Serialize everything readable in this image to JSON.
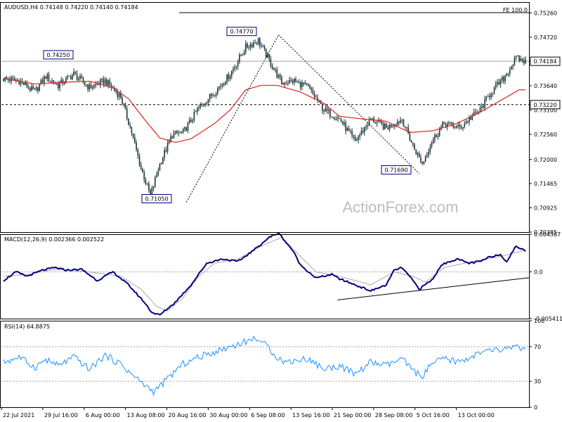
{
  "colors": {
    "candle": "#1a3535",
    "ma": "#dd2222",
    "macd": "#00007f",
    "signal": "#a8a8a8",
    "rsi": "#1e90ff",
    "trend": "#000000",
    "dotted": "#a0a0a0",
    "frame": "#000000",
    "watermark": "#bdbdbd",
    "label_bg": "#ffffff",
    "label_border": "#00007f"
  },
  "chart_data": [
    {
      "type": "candlestick",
      "title": "AUDUSD,H4  0.74148 0.74220 0.74140 0.74184",
      "watermark": "ActionForex.com",
      "fib_label": "FE 100.0",
      "ylim": [
        0.70385,
        0.755
      ],
      "y_ticks": [
        "0.75260",
        "0.74720",
        "0.74184",
        "0.73640",
        "0.73220",
        "0.73100",
        "0.72560",
        "0.72000",
        "0.71465",
        "0.70925",
        "0.70385"
      ],
      "last_price": 0.74184,
      "support_level": 0.7322,
      "annotations": [
        {
          "text": "0.74250",
          "value": 0.7425
        },
        {
          "text": "0.74770",
          "value": 0.7477
        },
        {
          "text": "0.71050",
          "value": 0.7105
        },
        {
          "text": "0.71690",
          "value": 0.7169
        }
      ],
      "moving_average_waypoints": [
        [
          0,
          0.738
        ],
        [
          20,
          0.7368
        ],
        [
          40,
          0.7372
        ],
        [
          55,
          0.7374
        ],
        [
          70,
          0.736
        ],
        [
          80,
          0.7335
        ],
        [
          90,
          0.729
        ],
        [
          100,
          0.7248
        ],
        [
          110,
          0.7238
        ],
        [
          120,
          0.7246
        ],
        [
          135,
          0.728
        ],
        [
          145,
          0.731
        ],
        [
          155,
          0.7355
        ],
        [
          165,
          0.7365
        ],
        [
          175,
          0.7365
        ],
        [
          190,
          0.735
        ],
        [
          205,
          0.7325
        ],
        [
          215,
          0.7296
        ],
        [
          230,
          0.729
        ],
        [
          245,
          0.7285
        ],
        [
          260,
          0.726
        ],
        [
          275,
          0.7264
        ],
        [
          290,
          0.728
        ],
        [
          305,
          0.7305
        ],
        [
          315,
          0.7325
        ],
        [
          330,
          0.7355
        ]
      ],
      "price_waypoints": [
        [
          0,
          0.738
        ],
        [
          10,
          0.7375
        ],
        [
          20,
          0.735
        ],
        [
          27,
          0.7385
        ],
        [
          35,
          0.7365
        ],
        [
          45,
          0.739
        ],
        [
          55,
          0.736
        ],
        [
          65,
          0.7375
        ],
        [
          75,
          0.734
        ],
        [
          82,
          0.726
        ],
        [
          88,
          0.718
        ],
        [
          94,
          0.712
        ],
        [
          100,
          0.719
        ],
        [
          108,
          0.7255
        ],
        [
          115,
          0.726
        ],
        [
          125,
          0.7315
        ],
        [
          135,
          0.735
        ],
        [
          145,
          0.739
        ],
        [
          155,
          0.745
        ],
        [
          163,
          0.7465
        ],
        [
          170,
          0.742
        ],
        [
          178,
          0.737
        ],
        [
          186,
          0.7375
        ],
        [
          195,
          0.736
        ],
        [
          205,
          0.731
        ],
        [
          215,
          0.729
        ],
        [
          225,
          0.724
        ],
        [
          235,
          0.729
        ],
        [
          245,
          0.727
        ],
        [
          255,
          0.729
        ],
        [
          262,
          0.723
        ],
        [
          268,
          0.719
        ],
        [
          274,
          0.724
        ],
        [
          282,
          0.728
        ],
        [
          292,
          0.727
        ],
        [
          298,
          0.729
        ],
        [
          305,
          0.731
        ],
        [
          312,
          0.735
        ],
        [
          320,
          0.738
        ],
        [
          328,
          0.7425
        ],
        [
          334,
          0.74184
        ]
      ],
      "fib_projection": [
        [
          176,
          0.7477
        ],
        [
          266,
          0.7169
        ]
      ],
      "fib_leg": [
        [
          117,
          0.7105
        ],
        [
          176,
          0.7477
        ]
      ]
    },
    {
      "type": "line",
      "title": "MACD(12,26,9) 0.002366 0.002522",
      "ylim": [
        -0.005411,
        0.004367
      ],
      "y_ticks": [
        "0.004367",
        "0.0",
        "-0.005411"
      ],
      "series": [
        {
          "name": "MACD(12,26,9)",
          "waypoints": [
            [
              0,
              -0.001
            ],
            [
              8,
              0.0
            ],
            [
              15,
              -0.0005
            ],
            [
              25,
              0.0002
            ],
            [
              33,
              0.0005
            ],
            [
              40,
              0.0002
            ],
            [
              50,
              0.0003
            ],
            [
              60,
              -0.001
            ],
            [
              70,
              0.0
            ],
            [
              80,
              -0.0015
            ],
            [
              90,
              -0.0035
            ],
            [
              95,
              -0.0047
            ],
            [
              100,
              -0.005
            ],
            [
              110,
              -0.0035
            ],
            [
              120,
              -0.0015
            ],
            [
              130,
              0.001
            ],
            [
              140,
              0.0015
            ],
            [
              150,
              0.0012
            ],
            [
              160,
              0.0025
            ],
            [
              170,
              0.004
            ],
            [
              176,
              0.0045
            ],
            [
              185,
              0.0025
            ],
            [
              190,
              0.0008
            ],
            [
              200,
              -0.0007
            ],
            [
              210,
              -0.0003
            ],
            [
              215,
              -0.0008
            ],
            [
              225,
              -0.0015
            ],
            [
              235,
              -0.0022
            ],
            [
              245,
              -0.0015
            ],
            [
              250,
              0.0002
            ],
            [
              255,
              0.0005
            ],
            [
              262,
              -0.001
            ],
            [
              266,
              -0.002
            ],
            [
              275,
              -0.0008
            ],
            [
              280,
              0.0008
            ],
            [
              290,
              0.0015
            ],
            [
              298,
              0.001
            ],
            [
              305,
              0.0012
            ],
            [
              312,
              0.0018
            ],
            [
              318,
              0.002
            ],
            [
              322,
              0.0012
            ],
            [
              328,
              0.003
            ],
            [
              334,
              0.0024
            ]
          ]
        },
        {
          "name": "Signal",
          "waypoints": [
            [
              0,
              -0.0005
            ],
            [
              15,
              -0.0003
            ],
            [
              33,
              0.0003
            ],
            [
              55,
              0.0
            ],
            [
              75,
              -0.0005
            ],
            [
              88,
              -0.002
            ],
            [
              98,
              -0.004
            ],
            [
              105,
              -0.0045
            ],
            [
              115,
              -0.003
            ],
            [
              125,
              -0.0005
            ],
            [
              135,
              0.001
            ],
            [
              150,
              0.0015
            ],
            [
              165,
              0.003
            ],
            [
              178,
              0.004
            ],
            [
              190,
              0.0018
            ],
            [
              200,
              0.0
            ],
            [
              215,
              -0.0005
            ],
            [
              235,
              -0.0015
            ],
            [
              250,
              0.0
            ],
            [
              262,
              -0.0005
            ],
            [
              270,
              -0.0012
            ],
            [
              282,
              0.0005
            ],
            [
              300,
              0.0012
            ],
            [
              318,
              0.0018
            ],
            [
              334,
              0.0025
            ]
          ]
        }
      ],
      "trendline": [
        [
          0.637,
          -0.00325
        ],
        [
          0.94,
          -0.001
        ]
      ]
    },
    {
      "type": "line",
      "title": "RSI(14) 64.8875",
      "ylim": [
        0,
        100
      ],
      "y_ticks": [
        "100",
        "70",
        "30",
        "0"
      ],
      "levels": [
        70,
        30
      ],
      "series": [
        {
          "name": "RSI(14)",
          "waypoints": [
            [
              0,
              52
            ],
            [
              10,
              58
            ],
            [
              20,
              46
            ],
            [
              27,
              55
            ],
            [
              35,
              48
            ],
            [
              45,
              58
            ],
            [
              55,
              44
            ],
            [
              65,
              60
            ],
            [
              75,
              50
            ],
            [
              82,
              38
            ],
            [
              90,
              26
            ],
            [
              96,
              18
            ],
            [
              100,
              24
            ],
            [
              110,
              42
            ],
            [
              115,
              50
            ],
            [
              125,
              58
            ],
            [
              135,
              64
            ],
            [
              145,
              70
            ],
            [
              155,
              76
            ],
            [
              162,
              80
            ],
            [
              170,
              68
            ],
            [
              175,
              58
            ],
            [
              180,
              52
            ],
            [
              186,
              54
            ],
            [
              195,
              56
            ],
            [
              205,
              44
            ],
            [
              215,
              48
            ],
            [
              225,
              38
            ],
            [
              235,
              52
            ],
            [
              245,
              48
            ],
            [
              255,
              56
            ],
            [
              262,
              42
            ],
            [
              268,
              36
            ],
            [
              274,
              50
            ],
            [
              282,
              56
            ],
            [
              292,
              52
            ],
            [
              298,
              58
            ],
            [
              305,
              62
            ],
            [
              312,
              66
            ],
            [
              320,
              66
            ],
            [
              328,
              72
            ],
            [
              334,
              64.9
            ]
          ]
        }
      ]
    }
  ],
  "x_axis_labels": [
    "22 Jul 2021",
    "29 Jul 16:00",
    "6 Aug 00:00",
    "13 Aug 08:00",
    "20 Aug 16:00",
    "30 Aug 00:00",
    "6 Sep 08:00",
    "13 Sep 16:00",
    "21 Sep 00:00",
    "28 Sep 08:00",
    "5 Oct 16:00",
    "13 Oct 00:00"
  ],
  "x_axis_label_positions": [
    0.0,
    0.0784,
    0.1568,
    0.2352,
    0.3136,
    0.392,
    0.4704,
    0.5488,
    0.6272,
    0.7056,
    0.784,
    0.8624
  ]
}
